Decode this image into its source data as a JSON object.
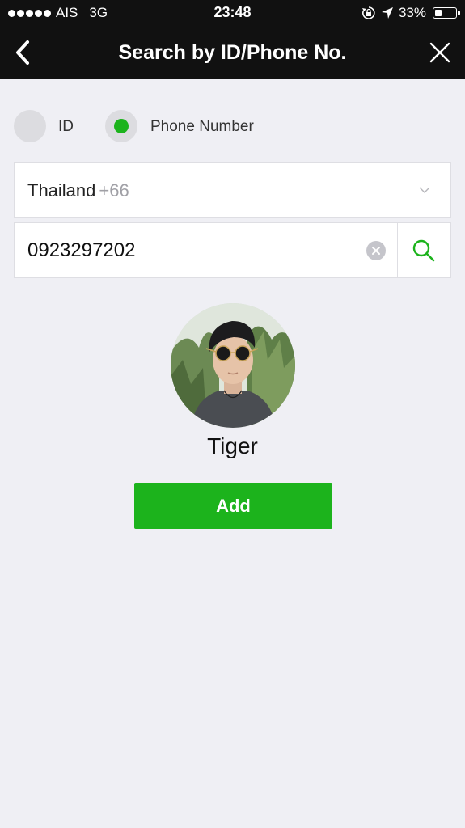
{
  "status_bar": {
    "carrier": "AIS",
    "network": "3G",
    "time": "23:48",
    "battery_percent_text": "33%",
    "battery_level": 0.33,
    "icons": [
      "signal-dots-icon",
      "rotation-lock-icon",
      "location-arrow-icon",
      "battery-icon"
    ]
  },
  "nav": {
    "title": "Search by ID/Phone No.",
    "back_icon": "back-chevron-icon",
    "close_icon": "close-icon"
  },
  "search_type": {
    "options": [
      {
        "label": "ID",
        "selected": false
      },
      {
        "label": "Phone Number",
        "selected": true
      }
    ]
  },
  "country": {
    "name": "Thailand",
    "code": "+66"
  },
  "phone": {
    "value": "0923297202"
  },
  "result": {
    "name": "Tiger",
    "add_label": "Add"
  },
  "colors": {
    "accent_green": "#1cb31c",
    "nav_background": "#111111",
    "page_background": "#efeff4"
  }
}
